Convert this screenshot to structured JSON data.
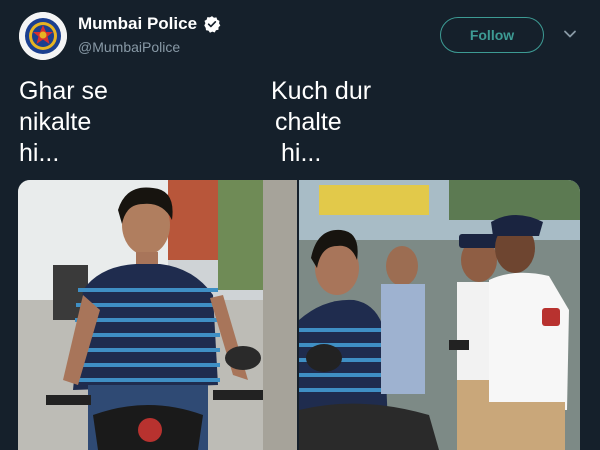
{
  "tweet": {
    "author": {
      "display_name": "Mumbai Police",
      "handle": "@MumbaiPolice",
      "verified": true,
      "avatar_icon": "police-emblem-icon"
    },
    "follow_label": "Follow",
    "text_left": [
      "Ghar se",
      "nikalte",
      "hi..."
    ],
    "text_right": [
      "Kuch dur",
      "chalte",
      "hi..."
    ],
    "media": [
      {
        "name": "photo-young-man-on-scooter"
      },
      {
        "name": "photo-young-man-with-traffic-police"
      }
    ]
  },
  "colors": {
    "background": "#15202b",
    "accent": "#3d9b94",
    "secondary_text": "#8899a6",
    "verified": "#ffffff"
  }
}
